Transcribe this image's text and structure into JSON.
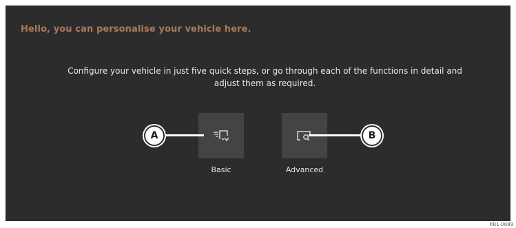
{
  "screen": {
    "headline": "Hello, you can personalise your vehicle here.",
    "intro": "Configure your vehicle in just five quick steps, or go through each of the functions in detail and adjust them as required."
  },
  "options": {
    "basic": {
      "label": "Basic",
      "icon": "quick-settings-icon",
      "callout": "A"
    },
    "advanced": {
      "label": "Advanced",
      "icon": "settings-search-icon",
      "callout": "B"
    }
  },
  "figure_code": "KR1-0089",
  "colors": {
    "background": "#2c2c2c",
    "tile": "#444444",
    "headline": "#a8795c",
    "text": "#e8e8e8"
  }
}
